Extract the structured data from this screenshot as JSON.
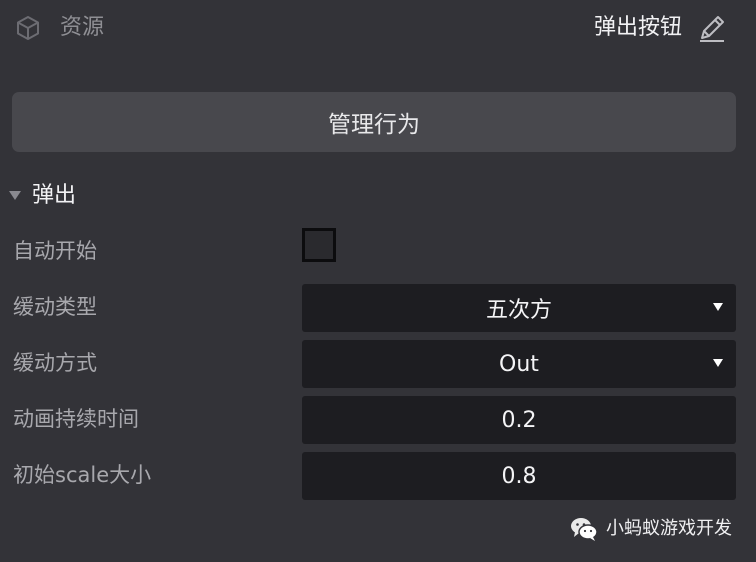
{
  "header": {
    "resource_icon": "cube-icon",
    "resource_label": "资源",
    "component_title": "弹出按钮",
    "edit_icon": "pencil-icon"
  },
  "manage_button_label": "管理行为",
  "section": {
    "icon": "triangle-down-icon",
    "title": "弹出"
  },
  "properties": {
    "autostart": {
      "label": "自动开始",
      "checked": false
    },
    "ease_type": {
      "label": "缓动类型",
      "value": "五次方"
    },
    "ease_mode": {
      "label": "缓动方式",
      "value": "Out"
    },
    "duration": {
      "label": "动画持续时间",
      "value": "0.2"
    },
    "initial_scale": {
      "label": "初始scale大小",
      "value": "0.8"
    }
  },
  "watermark": {
    "icon": "wechat-icon",
    "text": "小蚂蚁游戏开发"
  },
  "colors": {
    "panel_bg": "#333338",
    "button_bg": "#48484d",
    "field_bg": "#1d1d21"
  }
}
